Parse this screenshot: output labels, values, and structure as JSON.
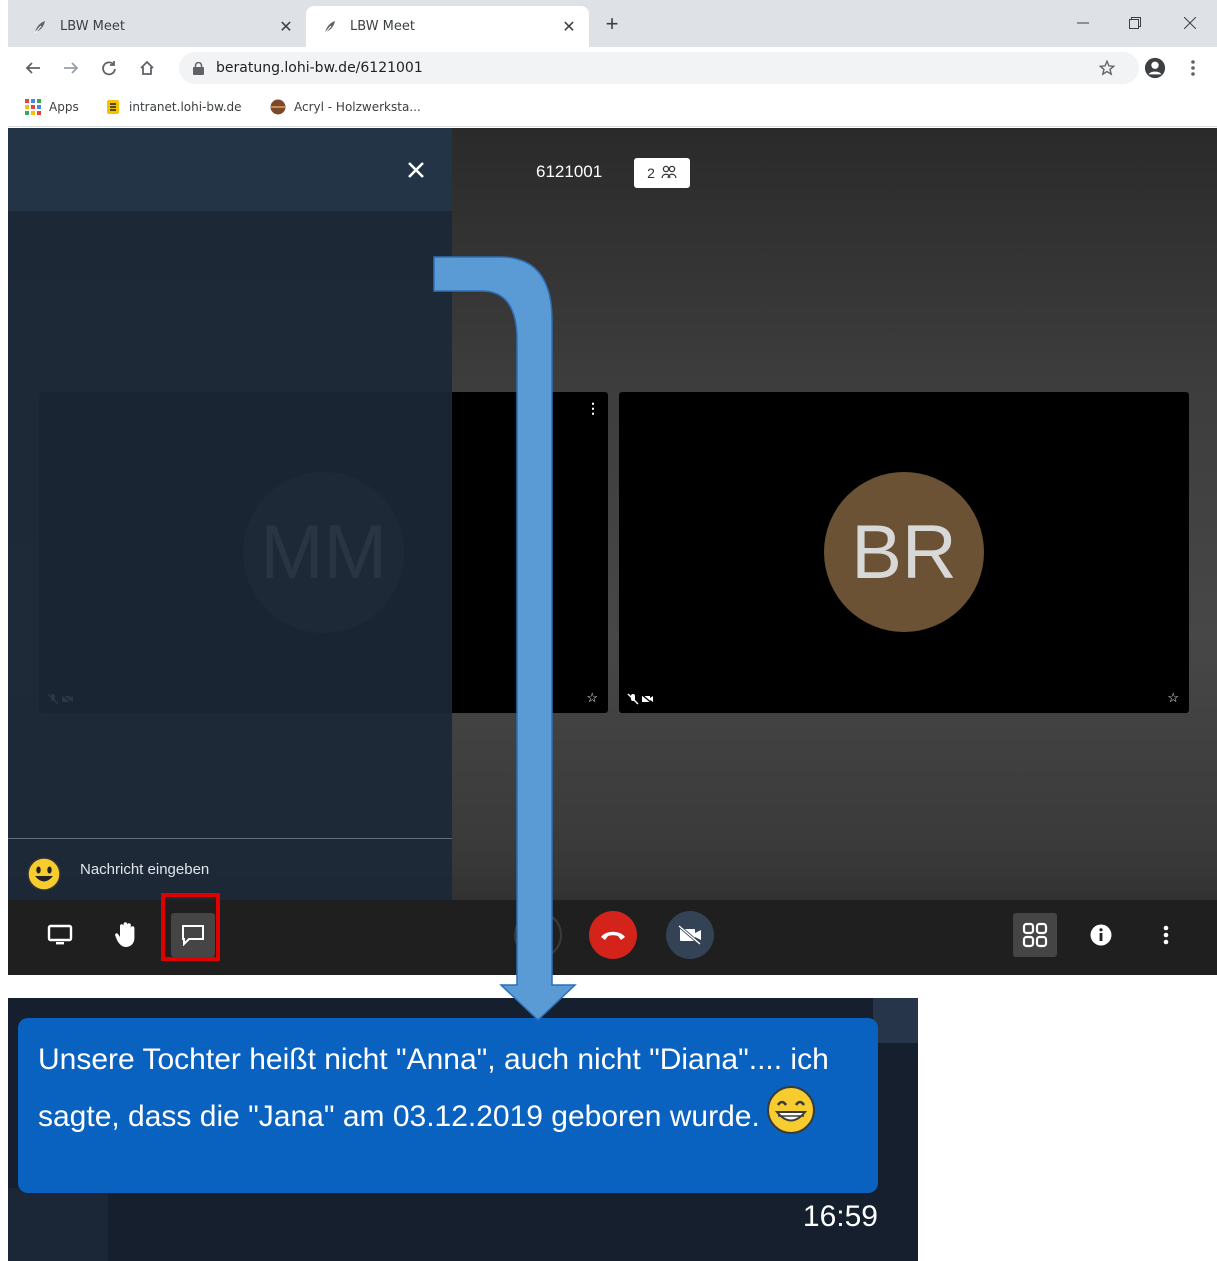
{
  "browser": {
    "tabs": [
      {
        "title": "LBW Meet",
        "active": false
      },
      {
        "title": "LBW Meet",
        "active": true
      }
    ],
    "address": "beratung.lohi-bw.de/6121001",
    "bookmarks": [
      "Apps",
      "intranet.lohi-bw.de",
      "Acryl - Holzwerksta..."
    ]
  },
  "meeting": {
    "room_number": "6121001",
    "participant_count": "2",
    "tiles": [
      {
        "initials": "MM",
        "avatar_color": "#3a3a3a"
      },
      {
        "initials": "BR",
        "avatar_color": "#6b5234"
      }
    ]
  },
  "chat": {
    "input_placeholder": "Nachricht eingeben"
  },
  "zoomed_message": {
    "text": "Unsere Tochter heißt nicht \"Anna\", auch nicht \"Diana\".... ich sagte, dass die \"Jana\" am 03.12.2019 geboren wurde.",
    "time": "16:59"
  },
  "colors": {
    "chat_bubble": "#0a62c0",
    "hangup": "#d3231b",
    "highlight": "#e00000",
    "arrow": "#5b9bd5"
  },
  "icons": [
    "tab-favicon-icon",
    "close-icon",
    "plus-icon",
    "minimize-icon",
    "restore-icon",
    "back-icon",
    "forward-icon",
    "reload-icon",
    "home-icon",
    "lock-icon",
    "star-icon",
    "profile-icon",
    "menu-dots-icon",
    "apps-grid-icon",
    "emoji-icon",
    "screen-share-icon",
    "raise-hand-icon",
    "chat-icon",
    "hangup-icon",
    "camera-off-icon",
    "tile-view-icon",
    "info-icon",
    "participants-icon"
  ]
}
